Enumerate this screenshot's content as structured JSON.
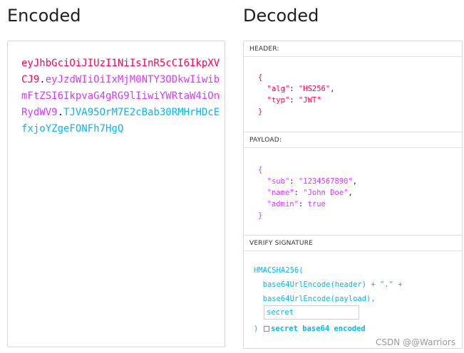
{
  "encoded": {
    "title": "Encoded",
    "token_header": "eyJhbGciOiJIUzI1NiIsInR5cCI6IkpXVCJ9",
    "dot1": ".",
    "token_payload": "eyJzdWIiOiIxMjM0NTY3ODkwIiwibmFtZSI6IkpvaG4gRG9lIiwiYWRtaW4iOnRydWV9",
    "dot2": ".",
    "token_signature": "TJVA95OrM7E2cBab30RMHrHDcEfxjoYZgeFONFh7HgQ"
  },
  "decoded": {
    "title": "Decoded",
    "header": {
      "label": "HEADER:",
      "open": "{",
      "alg_key": "\"alg\"",
      "alg_val": "\"HS256\"",
      "typ_key": "\"typ\"",
      "typ_val": "\"JWT\"",
      "close": "}"
    },
    "payload": {
      "label": "PAYLOAD:",
      "open": "{",
      "sub_key": "\"sub\"",
      "sub_val": "\"1234567890\"",
      "name_key": "\"name\"",
      "name_val": "\"John Doe\"",
      "admin_key": "\"admin\"",
      "admin_val": "true",
      "close": "}"
    },
    "signature": {
      "label": "VERIFY SIGNATURE",
      "line1": "HMACSHA256(",
      "line2": "  base64UrlEncode(header) + \".\" +",
      "line3": "  base64UrlEncode(payload),",
      "secret_value": "secret",
      "close": ")",
      "checkbox_label": "secret base64 encoded",
      "checkbox_checked": false
    }
  },
  "watermark": "CSDN @@Warriors",
  "colors": {
    "header": "#fb015b",
    "payload": "#d63aff",
    "signature": "#00b9f1"
  }
}
